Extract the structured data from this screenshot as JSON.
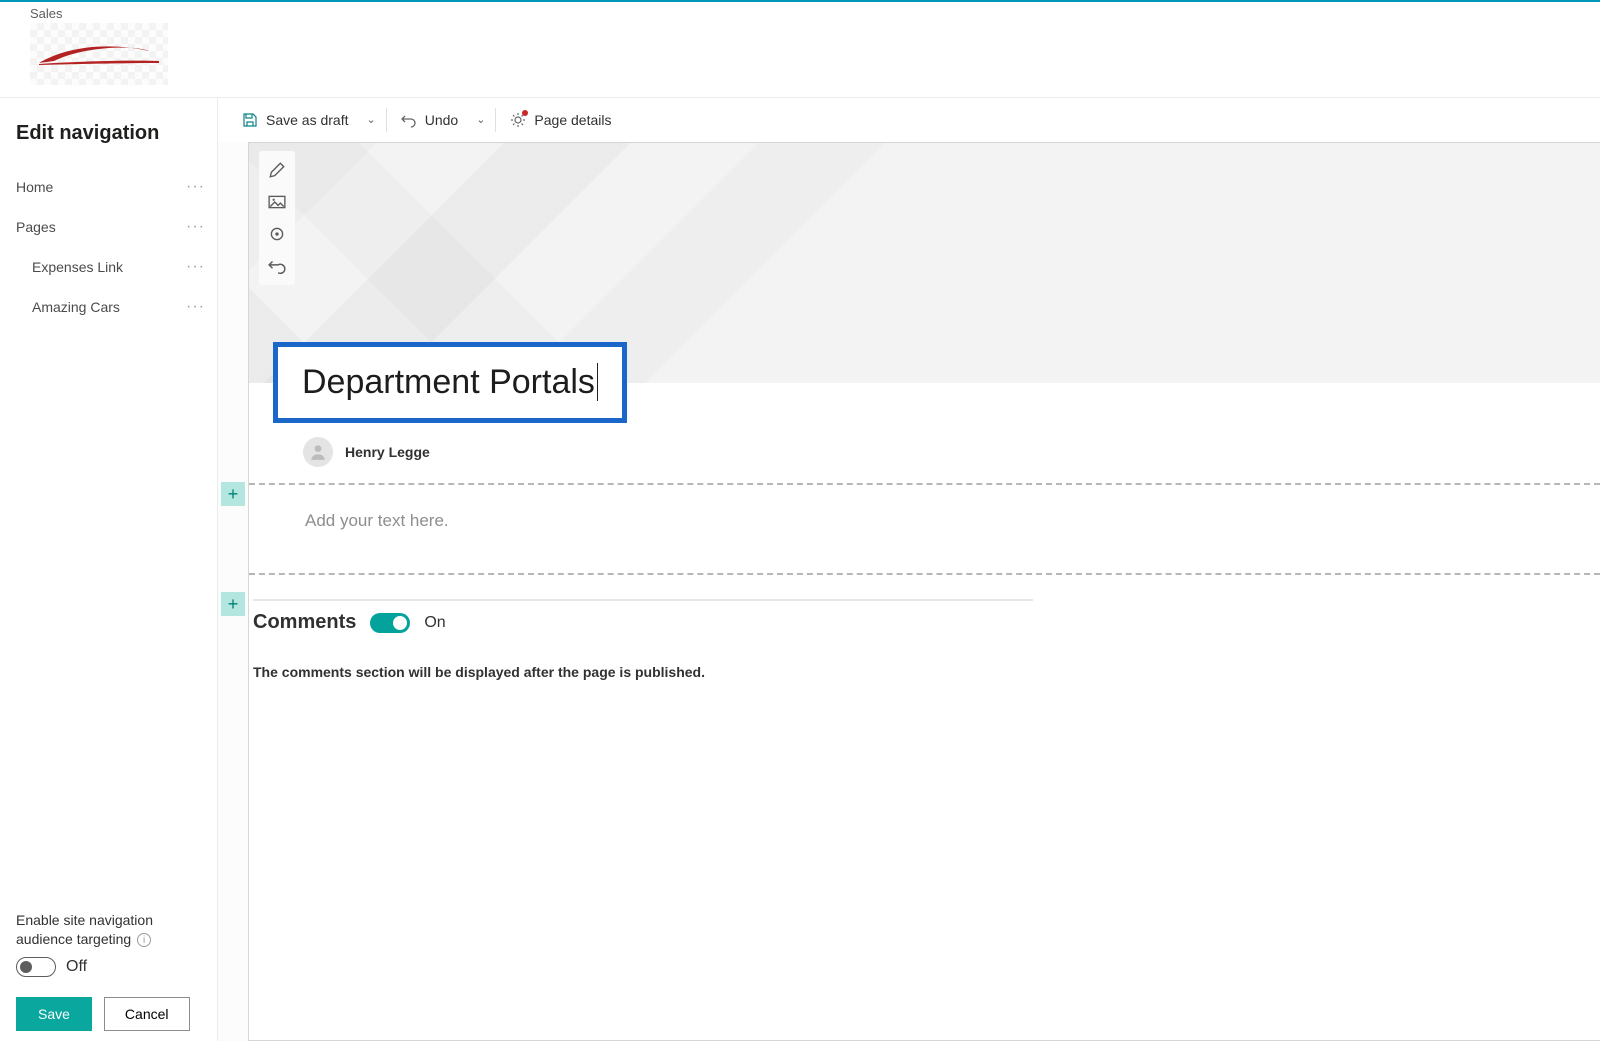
{
  "header": {
    "site_label": "Sales"
  },
  "sidebar": {
    "title": "Edit navigation",
    "items": [
      {
        "label": "Home",
        "child": false
      },
      {
        "label": "Pages",
        "child": false
      },
      {
        "label": "Expenses Link",
        "child": true
      },
      {
        "label": "Amazing Cars",
        "child": true
      }
    ],
    "audience": {
      "label": "Enable site navigation audience targeting",
      "state": "Off"
    },
    "save_label": "Save",
    "cancel_label": "Cancel"
  },
  "commandbar": {
    "save_draft": "Save as draft",
    "undo": "Undo",
    "page_details": "Page details"
  },
  "page": {
    "title": "Department Portals",
    "author": "Henry Legge",
    "text_placeholder": "Add your text here."
  },
  "comments": {
    "heading": "Comments",
    "state": "On",
    "note": "The comments section will be displayed after the page is published."
  }
}
